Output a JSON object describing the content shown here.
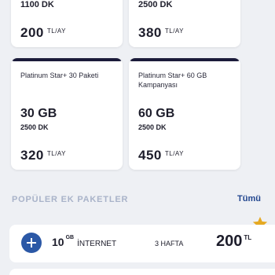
{
  "top_cards": [
    {
      "dk": "1100 DK",
      "price": "200",
      "unit": "TL/AY"
    },
    {
      "dk": "2500 DK",
      "price": "380",
      "unit": "TL/AY"
    }
  ],
  "packages": [
    {
      "name": "Platinum Star+ 30 Paketi",
      "gb": "30 GB",
      "dk": "2500 DK",
      "price": "320",
      "unit": "TL/AY"
    },
    {
      "name": "Platinum Star+ 60 GB Kampanyası",
      "gb": "60 GB",
      "dk": "2500 DK",
      "price": "450",
      "unit": "TL/AY"
    }
  ],
  "section": {
    "title": "POPÜLER EK PAKETLER",
    "see_all": "Tümü"
  },
  "addon": {
    "gb_value": "10",
    "gb_unit": "GB",
    "type": "İNTERNET",
    "duration": "3 HAFTA",
    "price": "200",
    "currency": "TL"
  },
  "colors": {
    "accent": "#1b1b3a",
    "link": "#22468f",
    "star": "#e5a923",
    "plus": "#2b58a6"
  }
}
